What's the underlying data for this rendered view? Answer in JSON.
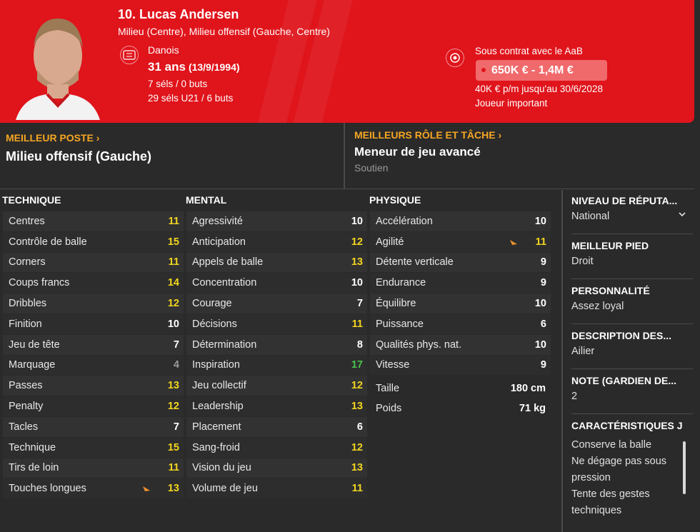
{
  "header": {
    "name": "10. Lucas Andersen",
    "positions": "Milieu (Centre), Milieu offensif (Gauche, Centre)",
    "nationality": "Danois",
    "age": "31 ans",
    "dob": "(13/9/1994)",
    "caps": "7 séls / 0 buts",
    "caps_u21": "29 séls U21 / 6 buts",
    "contract": "Sous contrat avec le AaB",
    "value": "650K € - 1,4M €",
    "wage": "40K € p/m jusqu'au 30/6/2028",
    "status": "Joueur important",
    "accent": "#e0141b"
  },
  "best_position": {
    "title": "MEILLEUR POSTE",
    "value": "Milieu offensif (Gauche)"
  },
  "best_role": {
    "title": "MEILLEURS RÔLE ET TÂCHE",
    "value": "Meneur de jeu avancé",
    "duty": "Soutien"
  },
  "columns": {
    "technique": "TECHNIQUE",
    "mental": "MENTAL",
    "physique": "PHYSIQUE"
  },
  "technique": [
    {
      "label": "Centres",
      "value": "11",
      "color": "yellow"
    },
    {
      "label": "Contrôle de balle",
      "value": "15",
      "color": "yellow"
    },
    {
      "label": "Corners",
      "value": "11",
      "color": "yellow"
    },
    {
      "label": "Coups francs",
      "value": "14",
      "color": "yellow"
    },
    {
      "label": "Dribbles",
      "value": "12",
      "color": "yellow"
    },
    {
      "label": "Finition",
      "value": "10",
      "color": "white"
    },
    {
      "label": "Jeu de tête",
      "value": "7",
      "color": "white"
    },
    {
      "label": "Marquage",
      "value": "4",
      "color": "gray"
    },
    {
      "label": "Passes",
      "value": "13",
      "color": "yellow"
    },
    {
      "label": "Penalty",
      "value": "12",
      "color": "yellow"
    },
    {
      "label": "Tacles",
      "value": "7",
      "color": "white"
    },
    {
      "label": "Technique",
      "value": "15",
      "color": "yellow"
    },
    {
      "label": "Tirs de loin",
      "value": "11",
      "color": "yellow"
    },
    {
      "label": "Touches longues",
      "value": "13",
      "color": "yellow",
      "arrow": true
    }
  ],
  "mental": [
    {
      "label": "Agressivité",
      "value": "10",
      "color": "white"
    },
    {
      "label": "Anticipation",
      "value": "12",
      "color": "yellow"
    },
    {
      "label": "Appels de balle",
      "value": "13",
      "color": "yellow"
    },
    {
      "label": "Concentration",
      "value": "10",
      "color": "white"
    },
    {
      "label": "Courage",
      "value": "7",
      "color": "white"
    },
    {
      "label": "Décisions",
      "value": "11",
      "color": "yellow"
    },
    {
      "label": "Détermination",
      "value": "8",
      "color": "white"
    },
    {
      "label": "Inspiration",
      "value": "17",
      "color": "green"
    },
    {
      "label": "Jeu collectif",
      "value": "12",
      "color": "yellow"
    },
    {
      "label": "Leadership",
      "value": "13",
      "color": "yellow"
    },
    {
      "label": "Placement",
      "value": "6",
      "color": "white"
    },
    {
      "label": "Sang-froid",
      "value": "12",
      "color": "yellow"
    },
    {
      "label": "Vision du jeu",
      "value": "13",
      "color": "yellow"
    },
    {
      "label": "Volume de jeu",
      "value": "11",
      "color": "yellow"
    }
  ],
  "physique": [
    {
      "label": "Accélération",
      "value": "10",
      "color": "white"
    },
    {
      "label": "Agilité",
      "value": "11",
      "color": "yellow",
      "arrow": true
    },
    {
      "label": "Détente verticale",
      "value": "9",
      "color": "white"
    },
    {
      "label": "Endurance",
      "value": "9",
      "color": "white"
    },
    {
      "label": "Équilibre",
      "value": "10",
      "color": "white"
    },
    {
      "label": "Puissance",
      "value": "6",
      "color": "white"
    },
    {
      "label": "Qualités phys. nat.",
      "value": "10",
      "color": "white"
    },
    {
      "label": "Vitesse",
      "value": "9",
      "color": "white"
    }
  ],
  "physical_info": {
    "height_label": "Taille",
    "height": "180 cm",
    "weight_label": "Poids",
    "weight": "71 kg"
  },
  "sidebar": {
    "reputation_title": "NIVEAU DE RÉPUTA...",
    "reputation": "National",
    "foot_title": "MEILLEUR PIED",
    "foot": "Droit",
    "personality_title": "PERSONNALITÉ",
    "personality": "Assez loyal",
    "description_title": "DESCRIPTION DES...",
    "description": "Ailier",
    "gk_title": "NOTE (GARDIEN DE...",
    "gk": "2",
    "traits_title": "CARACTÉRISTIQUES J",
    "traits": [
      "Conserve la balle",
      "Ne dégage pas sous",
      "pression",
      "Tente des gestes",
      "techniques"
    ]
  },
  "colors": {
    "yellow": "#f2d61f",
    "green": "#49c24d",
    "white": "#ffffff",
    "gray": "#9a9a9a",
    "gold": "#f5a623"
  }
}
